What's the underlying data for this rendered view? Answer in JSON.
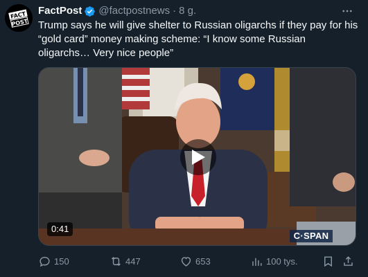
{
  "post": {
    "display_name": "FactPost",
    "handle": "@factpostnews",
    "separator": "·",
    "time": "8 g.",
    "text": "Trump says he will give shelter to Russian oligarchs if they pay for his “gold card” money making scheme: “I know some Russian oligarchs… Very nice people”",
    "avatar_text": [
      "FACT",
      "POST"
    ],
    "verified": true
  },
  "media": {
    "duration": "0:41",
    "watermark": "C·SPAN"
  },
  "actions": {
    "replies": "150",
    "reposts": "447",
    "likes": "653",
    "views": "100 tys."
  },
  "icons": [
    "more-icon",
    "verified-badge-icon",
    "play-icon",
    "reply-icon",
    "repost-icon",
    "like-icon",
    "views-icon",
    "bookmark-icon",
    "share-icon"
  ],
  "colors": {
    "background": "#15202b",
    "text": "#f7f9f9",
    "secondary": "#8b98a5",
    "verified": "#1d9bf0"
  }
}
